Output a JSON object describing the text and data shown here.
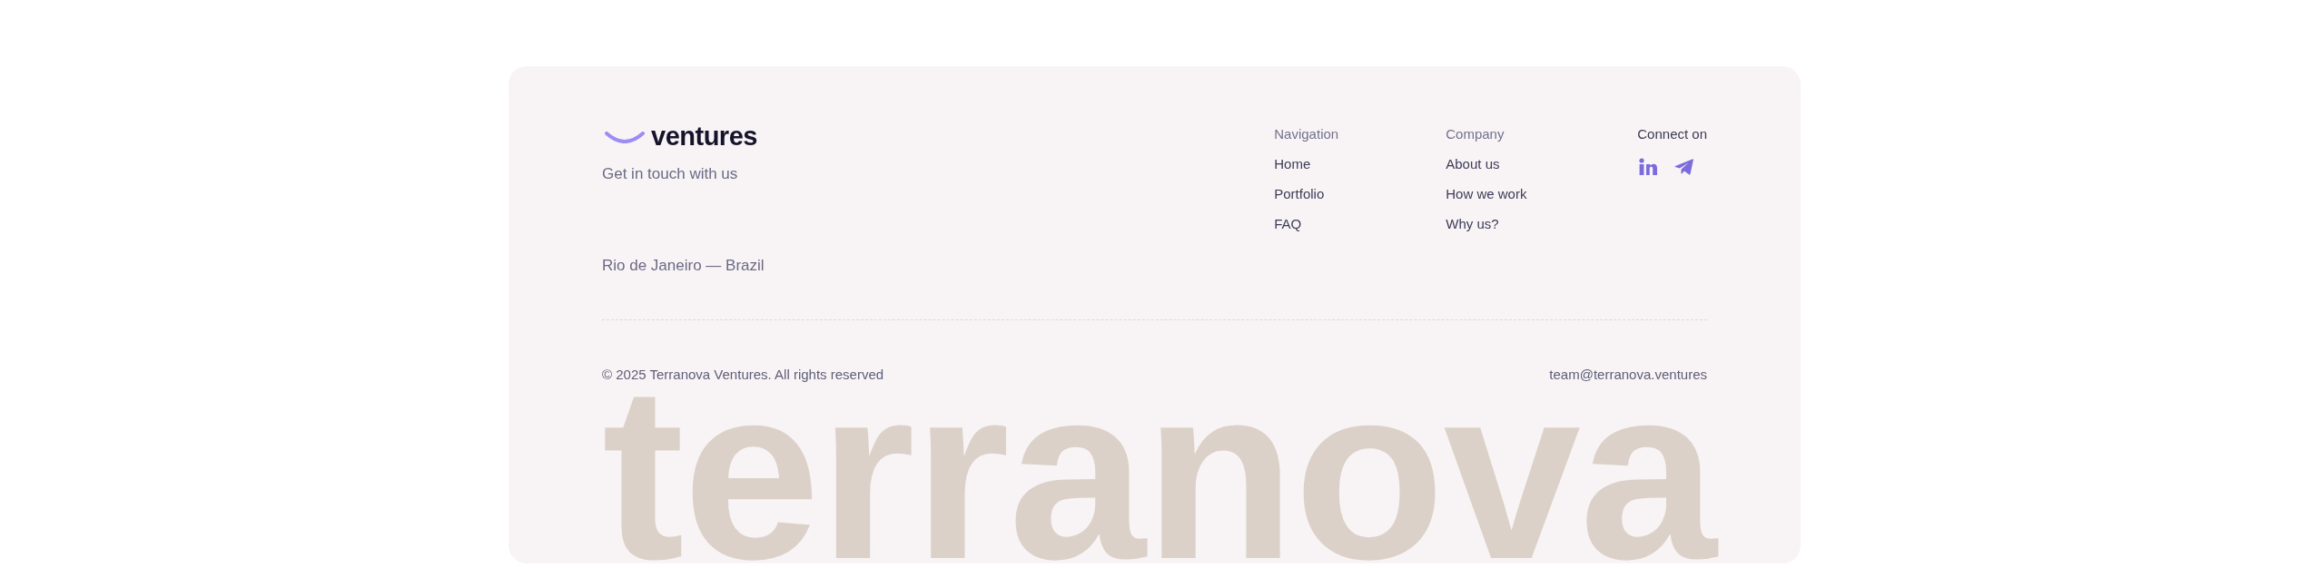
{
  "brand": {
    "name": "ventures",
    "tagline": "Get in touch with us",
    "location": "Rio de Janeiro — Brazil"
  },
  "columns": [
    {
      "heading": "Navigation",
      "links": [
        "Home",
        "Portfolio",
        "FAQ"
      ]
    },
    {
      "heading": "Company",
      "links": [
        "About us",
        "How we work",
        "Why us?"
      ]
    }
  ],
  "social": {
    "heading": "Connect on",
    "links": [
      {
        "kind": "linkedin"
      },
      {
        "kind": "telegram"
      }
    ]
  },
  "footer": {
    "copyright": "© 2025 Terranova Ventures. All rights reserved",
    "email": "team@terranova.ventures"
  },
  "wordmark": "terranova"
}
